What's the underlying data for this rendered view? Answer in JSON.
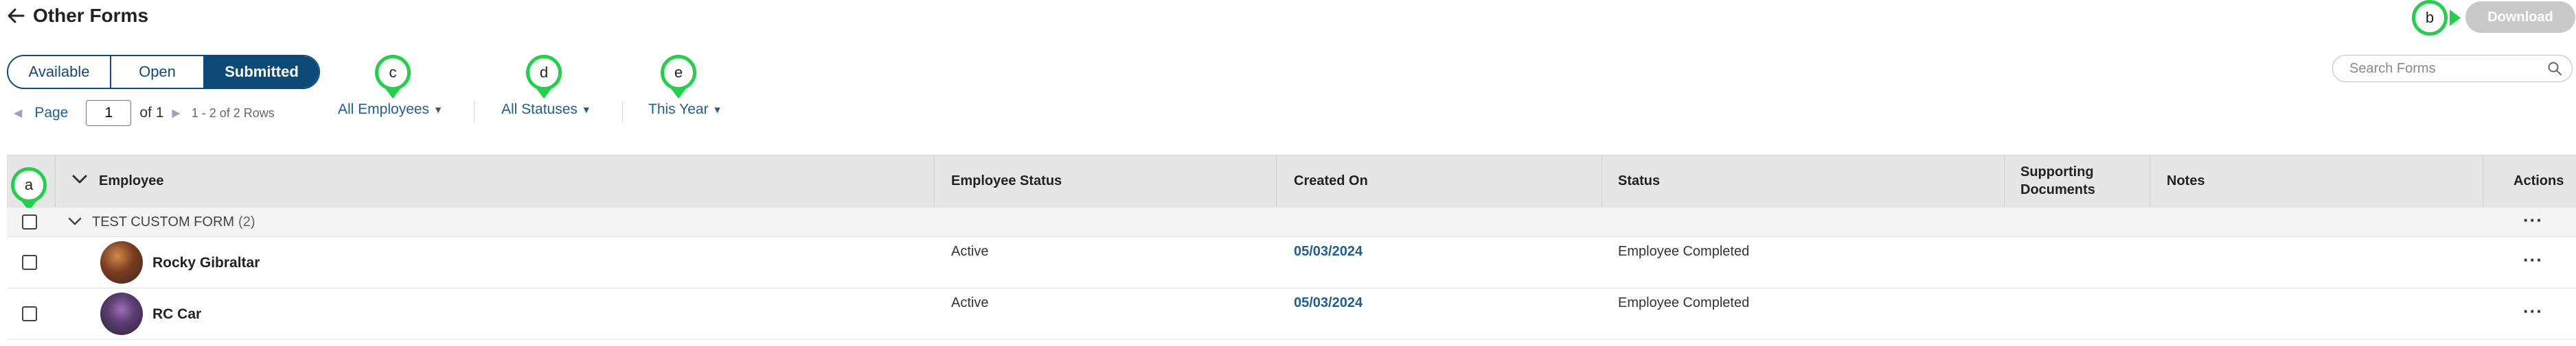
{
  "header": {
    "back_icon": "arrow-left-icon",
    "title": "Other Forms",
    "download_label": "Download"
  },
  "search": {
    "placeholder": "Search Forms",
    "value": "",
    "icon": "search-icon"
  },
  "tabs": [
    {
      "label": "Available",
      "active": false
    },
    {
      "label": "Open",
      "active": false
    },
    {
      "label": "Submitted",
      "active": true
    }
  ],
  "pagination": {
    "page_label": "Page",
    "current_page": "1",
    "of_text": "of 1",
    "rows_text": "1 - 2 of 2 Rows"
  },
  "filters": {
    "employees": "All Employees",
    "statuses": "All Statuses",
    "period": "This Year"
  },
  "markers": {
    "a": "a",
    "b": "b",
    "c": "c",
    "d": "d",
    "e": "e"
  },
  "table": {
    "columns": [
      "Employee",
      "Employee Status",
      "Created On",
      "Status",
      "Supporting Documents",
      "Notes",
      "Actions"
    ],
    "group": {
      "name": "TEST CUSTOM FORM",
      "count": "(2)"
    },
    "rows": [
      {
        "name": "Rocky Gibraltar",
        "employee_status": "Active",
        "created_on": "05/03/2024",
        "status": "Employee Completed"
      },
      {
        "name": "RC Car",
        "employee_status": "Active",
        "created_on": "05/03/2024",
        "status": "Employee Completed"
      }
    ],
    "actions_icon": "more-horizontal-icon"
  },
  "colors": {
    "primary": "#0d4a78",
    "link": "#1d5f95",
    "marker": "#22d14a",
    "download_disabled": "#c9c9c9",
    "header_bg": "#e6e6e6"
  }
}
